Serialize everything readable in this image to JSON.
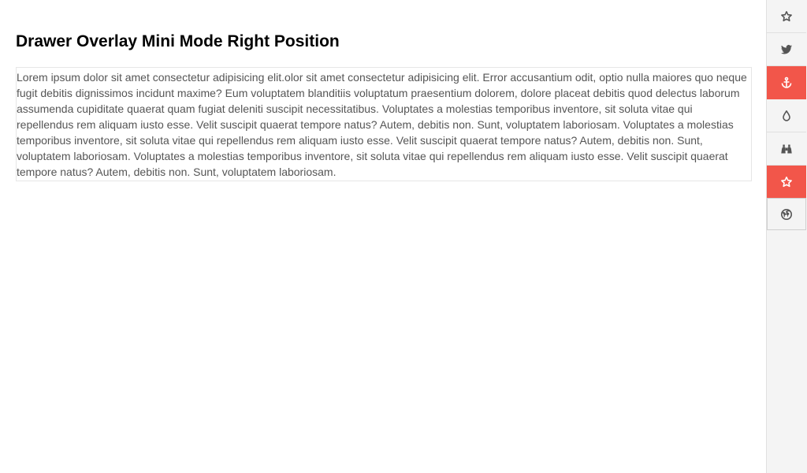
{
  "page": {
    "title": "Drawer Overlay Mini Mode Right Position",
    "body_text": "Lorem ipsum dolor sit amet consectetur adipisicing elit.olor sit amet consectetur adipisicing elit. Error accusantium odit, optio nulla maiores quo neque fugit debitis dignissimos incidunt maxime? Eum voluptatem blanditiis voluptatum praesentium dolorem, dolore placeat debitis quod delectus laborum assumenda cupiditate quaerat quam fugiat deleniti suscipit necessitatibus. Voluptates a molestias temporibus inventore, sit soluta vitae qui repellendus rem aliquam iusto esse. Velit suscipit quaerat tempore natus? Autem, debitis non. Sunt, voluptatem laboriosam. Voluptates a molestias temporibus inventore, sit soluta vitae qui repellendus rem aliquam iusto esse. Velit suscipit quaerat tempore natus? Autem, debitis non. Sunt, voluptatem laboriosam. Voluptates a molestias temporibus inventore, sit soluta vitae qui repellendus rem aliquam iusto esse. Velit suscipit quaerat tempore natus? Autem, debitis non. Sunt, voluptatem laboriosam."
  },
  "drawer": {
    "position": "right",
    "mode": "mini overlay",
    "accent_color": "#f2564a",
    "items": [
      {
        "icon": "star-outline-icon",
        "state": "default"
      },
      {
        "icon": "twitter-icon",
        "state": "default"
      },
      {
        "icon": "anchor-icon",
        "state": "active"
      },
      {
        "icon": "water-drop-icon",
        "state": "default"
      },
      {
        "icon": "binoculars-icon",
        "state": "default"
      },
      {
        "icon": "star-outline-icon",
        "state": "active"
      },
      {
        "icon": "globe-icon",
        "state": "focused"
      }
    ]
  }
}
